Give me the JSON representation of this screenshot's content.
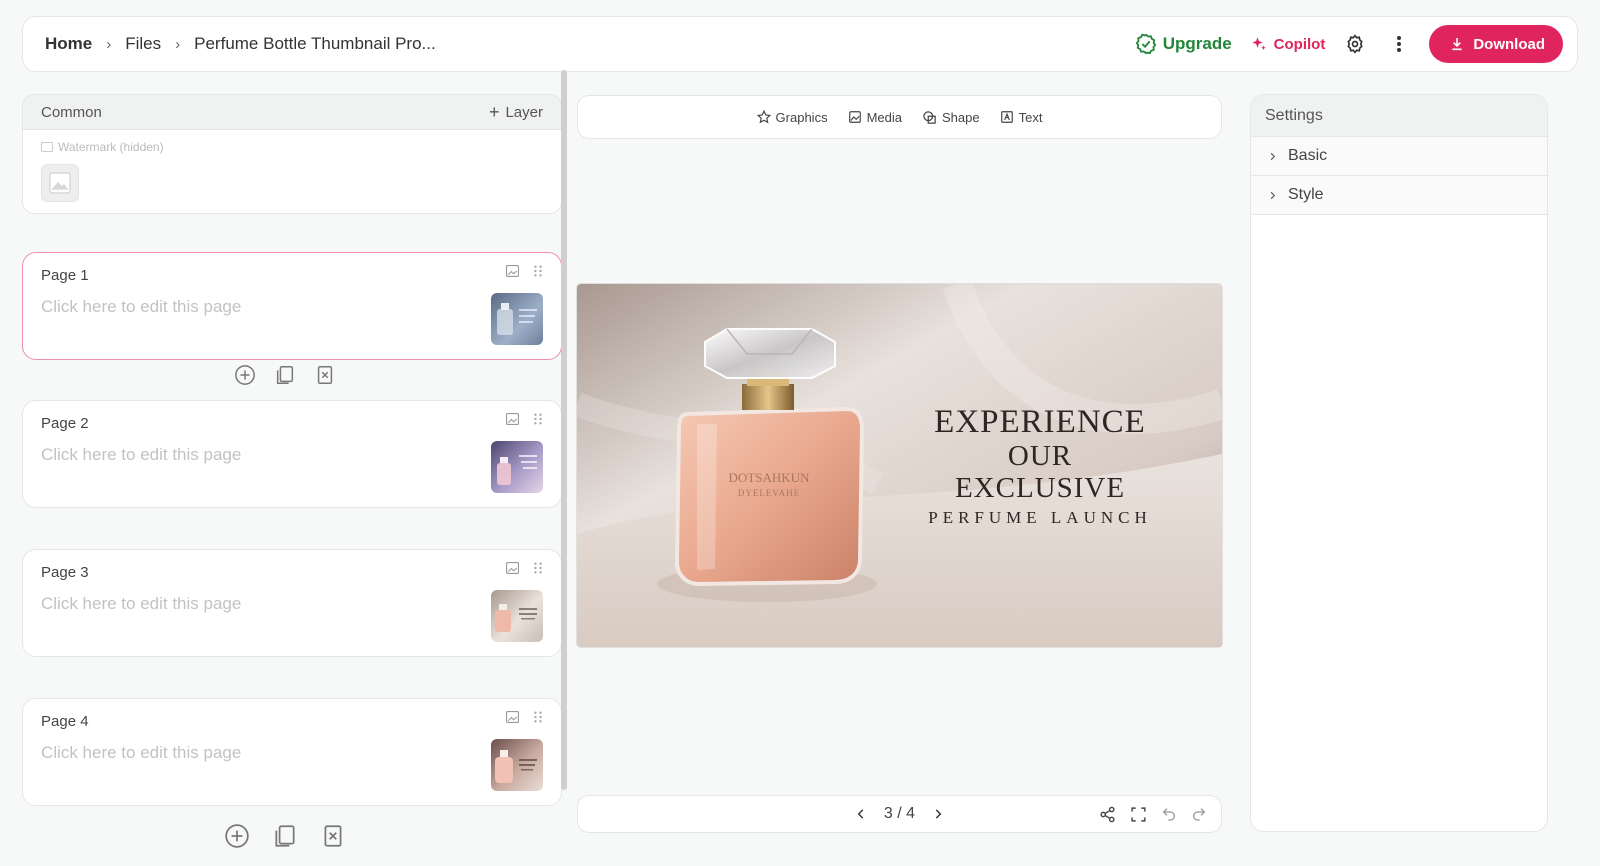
{
  "breadcrumb": {
    "home": "Home",
    "files": "Files",
    "current": "Perfume Bottle Thumbnail Pro..."
  },
  "topbar": {
    "upgrade": "Upgrade",
    "copilot": "Copilot",
    "download": "Download"
  },
  "left": {
    "common": {
      "title": "Common",
      "add_layer": "Layer",
      "watermark_label": "Watermark (hidden)"
    },
    "pages": [
      {
        "title": "Page 1",
        "hint": "Click here to edit this page"
      },
      {
        "title": "Page 2",
        "hint": "Click here to edit this page"
      },
      {
        "title": "Page 3",
        "hint": "Click here to edit this page"
      },
      {
        "title": "Page 4",
        "hint": "Click here to edit this page"
      }
    ]
  },
  "toolbar": {
    "graphics": "Graphics",
    "media": "Media",
    "shape": "Shape",
    "text": "Text"
  },
  "slide": {
    "line1": "EXPERIENCE",
    "line2": "OUR EXCLUSIVE",
    "line3": "PERFUME LAUNCH",
    "bottle_label1": "DOTSAHKUN",
    "bottle_label2": "DYELEVAHE"
  },
  "pager": {
    "indicator": "3 / 4"
  },
  "settings": {
    "title": "Settings",
    "sections": [
      "Basic",
      "Style"
    ]
  },
  "colors": {
    "accent": "#e0245e",
    "upgrade": "#22863a"
  }
}
